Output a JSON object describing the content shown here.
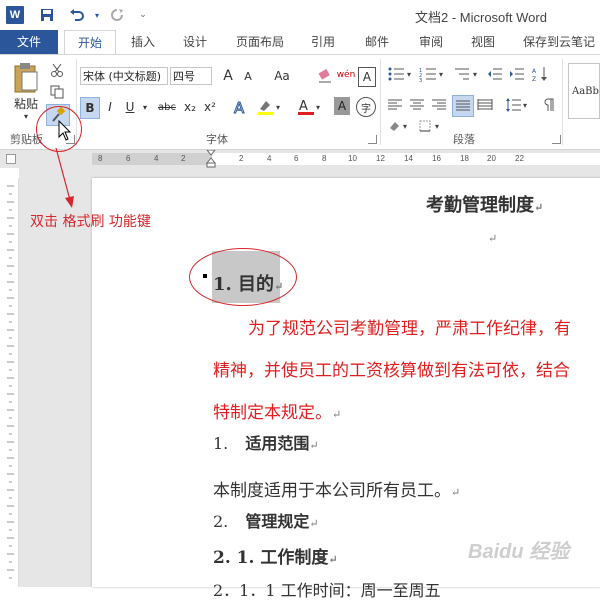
{
  "window": {
    "title": "文档2 - Microsoft Word"
  },
  "quick_access": {
    "icons": [
      "word-icon",
      "save-icon",
      "undo-icon",
      "redo-icon",
      "customize-icon"
    ]
  },
  "tabs": [
    {
      "label": "文件"
    },
    {
      "label": "开始"
    },
    {
      "label": "插入"
    },
    {
      "label": "设计"
    },
    {
      "label": "页面布局"
    },
    {
      "label": "引用"
    },
    {
      "label": "邮件"
    },
    {
      "label": "审阅"
    },
    {
      "label": "视图"
    },
    {
      "label": "保存到云笔记"
    }
  ],
  "ribbon": {
    "clipboard": {
      "paste_label": "粘贴",
      "group_label": "剪贴板"
    },
    "font": {
      "font_name": "宋体 (中文标题)",
      "font_size": "四号",
      "group_label": "字体",
      "bold": "B",
      "italic": "I",
      "underline": "U",
      "strike": "abc",
      "sub": "x₂",
      "sup": "x²",
      "grow": "A",
      "shrink": "A",
      "case": "Aa",
      "pinyin": "wén",
      "border_char": "A",
      "enclose": "字"
    },
    "paragraph": {
      "group_label": "段落"
    },
    "styles": {
      "preview": "AaBb"
    }
  },
  "ruler": {
    "ticks": [
      "8",
      "6",
      "4",
      "2",
      "2",
      "4",
      "6",
      "8",
      "10",
      "12",
      "14",
      "16",
      "18",
      "20",
      "22"
    ]
  },
  "annotation": {
    "text": "双击 格式刷 功能键"
  },
  "document": {
    "title": "考勤管理制度",
    "heading1": "1. 目的",
    "para1_line1": "为了规范公司考勤管理，严肃工作纪律，有",
    "para1_line2": "精神，并使员工的工资核算做到有法可依，结合",
    "para1_line3": "特制定本规定。",
    "item1_num": "1.",
    "item1_text": "适用范围",
    "para2": "本制度适用于本公司所有员工。",
    "item2_num": "2.",
    "item2_text": "管理规定",
    "heading21": "2. 1. 工作制度",
    "para3_partial": "2．1．1 工作时间：周一至周五"
  },
  "watermark": {
    "text": "Baidu 经验"
  },
  "colors": {
    "accent": "#2b579a",
    "annotation_red": "#d7262b",
    "doc_red": "#e02020"
  }
}
